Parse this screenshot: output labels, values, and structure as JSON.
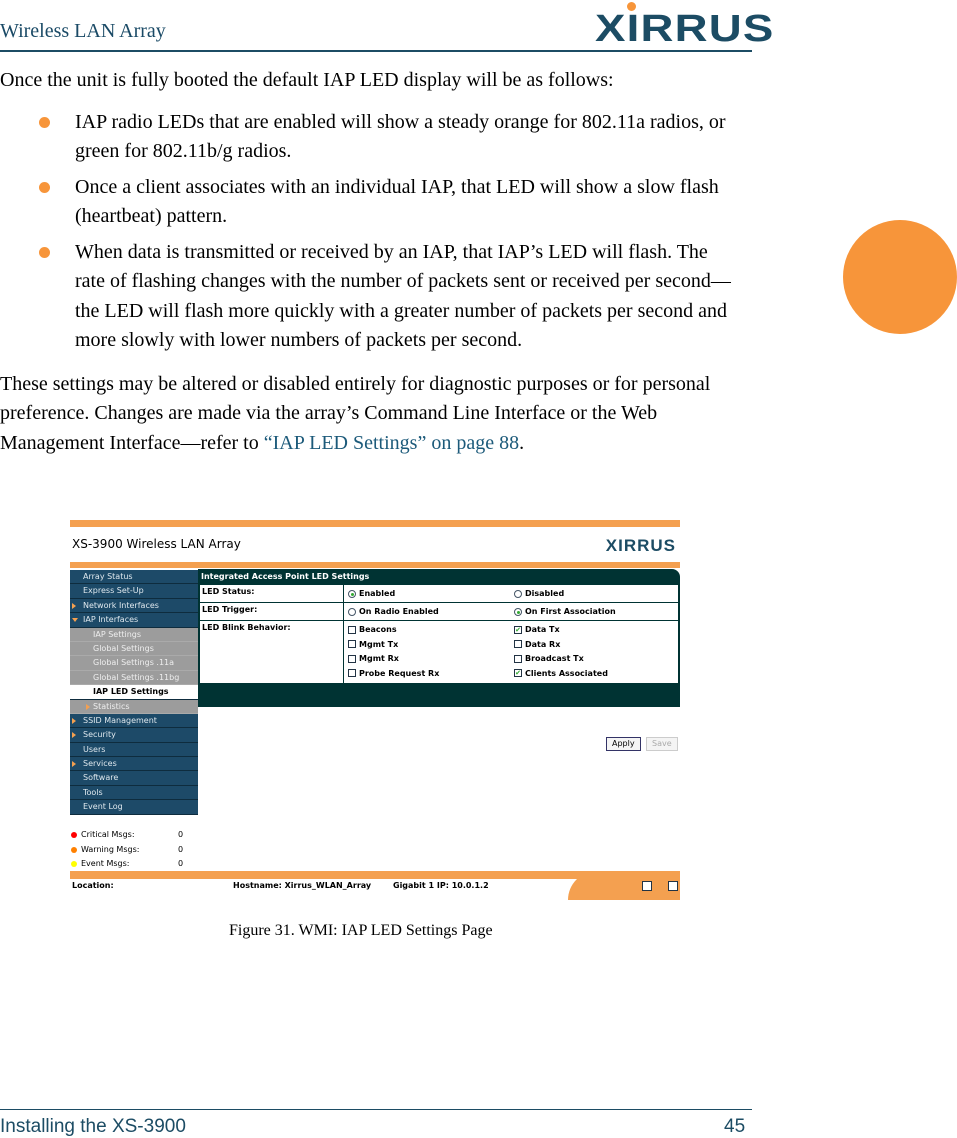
{
  "header": {
    "title": "Wireless LAN Array",
    "logo": "XIRRUS"
  },
  "body": {
    "intro": "Once the unit is fully booted the default IAP LED display will be as follows:",
    "bullets": [
      "IAP radio LEDs that are enabled will show a steady orange for 802.11a radios, or green for 802.11b/g radios.",
      "Once a client associates with an individual IAP, that LED will show a slow flash (heartbeat) pattern.",
      "When data is transmitted or received by an IAP, that IAP’s LED will flash. The rate of flashing changes with the number of packets sent or received per second—the LED will flash more quickly with a greater number of packets per second and more slowly with lower numbers of packets per second."
    ],
    "para": "These settings may be altered or disabled entirely for diagnostic purposes or for personal preference. Changes are made via the array’s Command Line Interface or the Web Management Interface—refer to ",
    "link": "“IAP LED Settings” on page 88",
    "para_end": "."
  },
  "screenshot": {
    "app_title": "XS-3900 Wireless LAN Array",
    "logo": "XIRRUS",
    "sidebar": [
      {
        "label": "Array Status",
        "type": "top",
        "arrow": ""
      },
      {
        "label": "Express Set-Up",
        "type": "top",
        "arrow": ""
      },
      {
        "label": "Network Interfaces",
        "type": "top",
        "arrow": "right"
      },
      {
        "label": "IAP Interfaces",
        "type": "top",
        "arrow": "down"
      },
      {
        "label": "IAP Settings",
        "type": "sub",
        "arrow": ""
      },
      {
        "label": "Global Settings",
        "type": "sub",
        "arrow": ""
      },
      {
        "label": "Global Settings .11a",
        "type": "sub",
        "arrow": ""
      },
      {
        "label": "Global Settings .11bg",
        "type": "sub",
        "arrow": ""
      },
      {
        "label": "IAP LED Settings",
        "type": "act",
        "arrow": ""
      },
      {
        "label": "Statistics",
        "type": "sub",
        "arrow": "right"
      },
      {
        "label": "SSID Management",
        "type": "top",
        "arrow": "right"
      },
      {
        "label": "Security",
        "type": "top",
        "arrow": "right"
      },
      {
        "label": "Users",
        "type": "top",
        "arrow": ""
      },
      {
        "label": "Services",
        "type": "top",
        "arrow": "right"
      },
      {
        "label": "Software",
        "type": "top",
        "arrow": ""
      },
      {
        "label": "Tools",
        "type": "top",
        "arrow": ""
      },
      {
        "label": "Event Log",
        "type": "top",
        "arrow": ""
      }
    ],
    "messages": [
      {
        "label": "Critical Msgs:",
        "value": "0",
        "color": "#ff0000"
      },
      {
        "label": "Warning Msgs:",
        "value": "0",
        "color": "#ff8000"
      },
      {
        "label": "Event Msgs:",
        "value": "0",
        "color": "#ffff00"
      }
    ],
    "panel": {
      "title": "Integrated Access Point LED Settings",
      "led_status": {
        "label": "LED Status:",
        "options": [
          "Enabled",
          "Disabled"
        ],
        "selected": "Enabled"
      },
      "led_trigger": {
        "label": "LED Trigger:",
        "options": [
          "On Radio Enabled",
          "On First Association"
        ],
        "selected": "On First Association"
      },
      "blink": {
        "label": "LED Blink Behavior:",
        "items": [
          {
            "label": "Beacons",
            "checked": false
          },
          {
            "label": "Data Tx",
            "checked": true
          },
          {
            "label": "Mgmt Tx",
            "checked": false
          },
          {
            "label": "Data Rx",
            "checked": false
          },
          {
            "label": "Mgmt Rx",
            "checked": false
          },
          {
            "label": "Broadcast Tx",
            "checked": false
          },
          {
            "label": "Probe Request Rx",
            "checked": false
          },
          {
            "label": "Clients Associated",
            "checked": true
          }
        ]
      },
      "apply": "Apply",
      "save": "Save"
    },
    "footer": {
      "location": "Location:",
      "hostname": "Hostname: Xirrus_WLAN_Array",
      "ip": "Gigabit 1 IP: 10.0.1.2"
    }
  },
  "caption": "Figure 31. WMI: IAP LED Settings Page",
  "footer": {
    "section": "Installing the XS-3900",
    "page": "45"
  },
  "colors": {
    "accent": "#f7953a",
    "brand": "#1c4c64",
    "panel": "#003333",
    "sidebar": "#1d4a68"
  }
}
